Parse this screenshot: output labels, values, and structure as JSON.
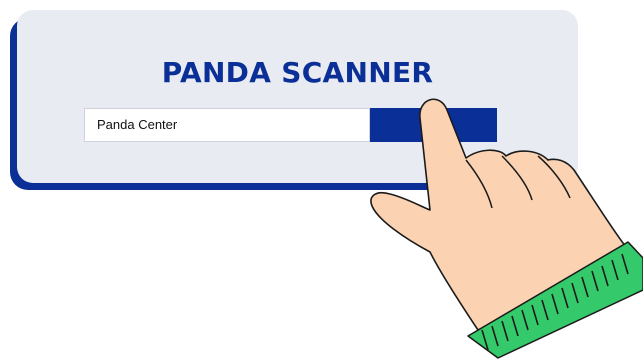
{
  "app": {
    "title": "PANDA SCANNER"
  },
  "search": {
    "value": "Panda Center",
    "button_label": ""
  },
  "colors": {
    "brand_blue": "#0a2f96",
    "card_background": "#e9ebf3",
    "skin": "#fbd3b3",
    "cuff": "#34c96a"
  },
  "illustration": {
    "icon": "pointing-hand-icon"
  }
}
